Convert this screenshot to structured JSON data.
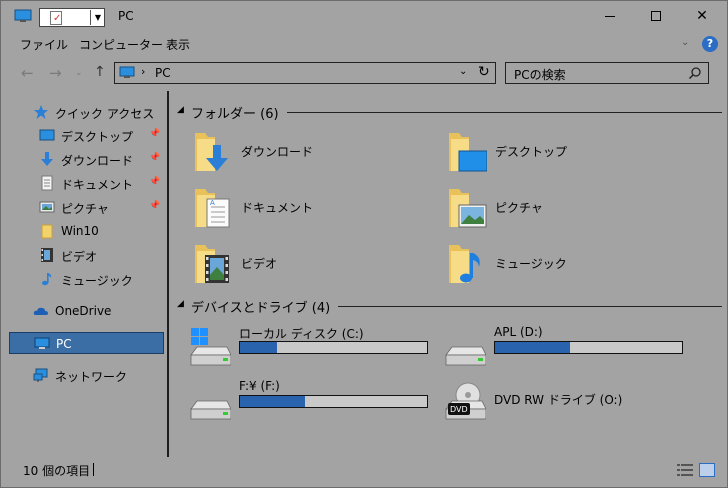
{
  "window": {
    "title": "PC",
    "controls": {
      "minimize": "minimize",
      "maximize": "maximize",
      "close": "✕"
    }
  },
  "ribbon": {
    "tabs": [
      {
        "label": "ファイル"
      },
      {
        "label": "コンピューター"
      },
      {
        "label": "表示"
      }
    ],
    "help": "?"
  },
  "nav": {
    "address_path": "PC",
    "search_placeholder": "PCの検索"
  },
  "sidebar": {
    "items": [
      {
        "label": "クイック アクセス",
        "icon": "star-icon"
      },
      {
        "label": "デスクトップ",
        "icon": "desktop-icon",
        "pinned": true
      },
      {
        "label": "ダウンロード",
        "icon": "download-icon",
        "pinned": true
      },
      {
        "label": "ドキュメント",
        "icon": "documents-icon",
        "pinned": true
      },
      {
        "label": "ピクチャ",
        "icon": "pictures-icon",
        "pinned": true
      },
      {
        "label": "Win10",
        "icon": "folder-icon"
      },
      {
        "label": "ビデオ",
        "icon": "videos-icon"
      },
      {
        "label": "ミュージック",
        "icon": "music-icon"
      },
      {
        "label": "OneDrive",
        "icon": "cloud-icon"
      },
      {
        "label": "PC",
        "icon": "computer-icon",
        "selected": true
      },
      {
        "label": "ネットワーク",
        "icon": "network-icon"
      }
    ]
  },
  "content": {
    "folders_group": "フォルダー (6)",
    "folders": [
      {
        "label": "ダウンロード",
        "icon": "download-folder-icon"
      },
      {
        "label": "デスクトップ",
        "icon": "desktop-folder-icon"
      },
      {
        "label": "ドキュメント",
        "icon": "documents-folder-icon"
      },
      {
        "label": "ピクチャ",
        "icon": "pictures-folder-icon"
      },
      {
        "label": "ビデオ",
        "icon": "videos-folder-icon"
      },
      {
        "label": "ミュージック",
        "icon": "music-folder-icon"
      }
    ],
    "drives_group": "デバイスとドライブ (4)",
    "drives": [
      {
        "label": "ローカル ディスク (C:)",
        "icon": "windows-drive-icon",
        "used_fraction": 0.2
      },
      {
        "label": "APL (D:)",
        "icon": "hard-drive-icon",
        "used_fraction": 0.4
      },
      {
        "label": "F:¥ (F:)",
        "icon": "hard-drive-icon",
        "used_fraction": 0.35
      },
      {
        "label": "DVD RW ドライブ (O:)",
        "icon": "dvd-drive-icon"
      }
    ]
  },
  "status": {
    "item_count": "10 個の項目"
  },
  "colors": {
    "window_bg": "#a3a3a3",
    "selection": "#3a6ea5",
    "drive_fill": "#2a63ad",
    "accent_blue": "#2b6cc4"
  }
}
